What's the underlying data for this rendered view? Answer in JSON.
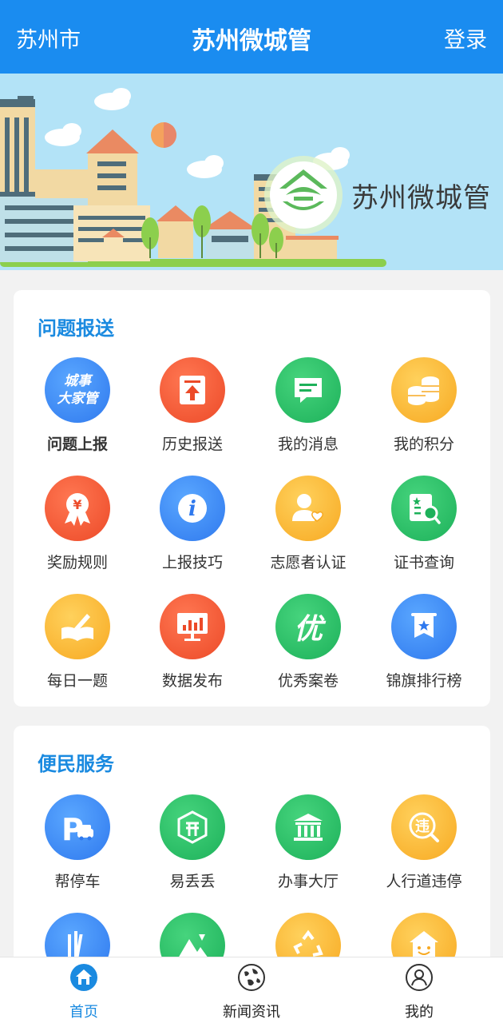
{
  "header": {
    "city": "苏州市",
    "title": "苏州微城管",
    "login": "登录"
  },
  "banner": {
    "brand": "苏州微城管"
  },
  "section1": {
    "title": "问题报送",
    "items": [
      {
        "label": "问题上报",
        "icon": "city-affairs-icon",
        "badge_line1": "城事",
        "badge_line2": "大家管"
      },
      {
        "label": "历史报送",
        "icon": "upload-history-icon"
      },
      {
        "label": "我的消息",
        "icon": "message-icon"
      },
      {
        "label": "我的积分",
        "icon": "coins-icon"
      },
      {
        "label": "奖励规则",
        "icon": "award-icon",
        "symbol": "¥"
      },
      {
        "label": "上报技巧",
        "icon": "info-icon",
        "symbol": "i"
      },
      {
        "label": "志愿者认证",
        "icon": "volunteer-icon"
      },
      {
        "label": "证书查询",
        "icon": "certificate-search-icon"
      },
      {
        "label": "每日一题",
        "icon": "book-pen-icon"
      },
      {
        "label": "数据发布",
        "icon": "data-chart-icon"
      },
      {
        "label": "优秀案卷",
        "icon": "excellent-icon",
        "symbol": "优"
      },
      {
        "label": "锦旗排行榜",
        "icon": "banner-flag-icon"
      }
    ]
  },
  "section2": {
    "title": "便民服务",
    "items": [
      {
        "label": "帮停车",
        "icon": "parking-icon",
        "symbol": "P"
      },
      {
        "label": "易丢丢",
        "icon": "trash-box-icon"
      },
      {
        "label": "办事大厅",
        "icon": "hall-icon"
      },
      {
        "label": "人行道违停",
        "icon": "violation-icon",
        "symbol": "违"
      },
      {
        "label": "",
        "icon": "bars-icon"
      },
      {
        "label": "",
        "icon": "mountain-icon"
      },
      {
        "label": "",
        "icon": "recycle-icon"
      },
      {
        "label": "",
        "icon": "house-face-icon"
      }
    ]
  },
  "tabbar": [
    {
      "label": "首页",
      "icon": "home-icon",
      "active": true
    },
    {
      "label": "新闻资讯",
      "icon": "globe-icon",
      "active": false
    },
    {
      "label": "我的",
      "icon": "user-icon",
      "active": false
    }
  ],
  "colors": {
    "primary": "#1a8cf0",
    "blue": "#2f79ee",
    "red": "#ec4a28",
    "green": "#1db15a",
    "orange": "#f7a922"
  }
}
